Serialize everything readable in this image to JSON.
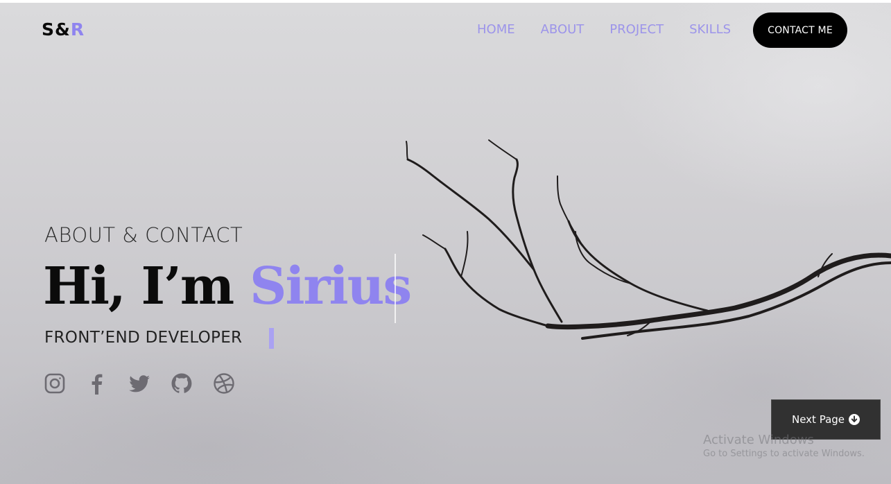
{
  "logo": {
    "prefix": "S&",
    "accent": "R"
  },
  "nav": {
    "items": [
      {
        "label": "HOME"
      },
      {
        "label": "ABOUT"
      },
      {
        "label": "PROJECT"
      },
      {
        "label": "SKILLS"
      }
    ],
    "contact_label": "CONTACT ME"
  },
  "hero": {
    "eyebrow": "ABOUT & CONTACT",
    "greeting": "Hi, I’m ",
    "name": "Sirius",
    "role": "FRONT’END DEVELOPER"
  },
  "social": {
    "icons": [
      "instagram-icon",
      "facebook-icon",
      "twitter-icon",
      "github-icon",
      "dribbble-icon"
    ]
  },
  "next_page": {
    "label": "Next Page",
    "icon": "arrow-down-circle-icon"
  },
  "watermark": {
    "line1": "Activate Windows",
    "line2": "Go to Settings to activate Windows."
  },
  "colors": {
    "accent": "#8f84ef",
    "nav_text": "#9c94ea",
    "cursor": "#aaa2f2",
    "button_dark": "#000000",
    "next_button": "#313131"
  }
}
